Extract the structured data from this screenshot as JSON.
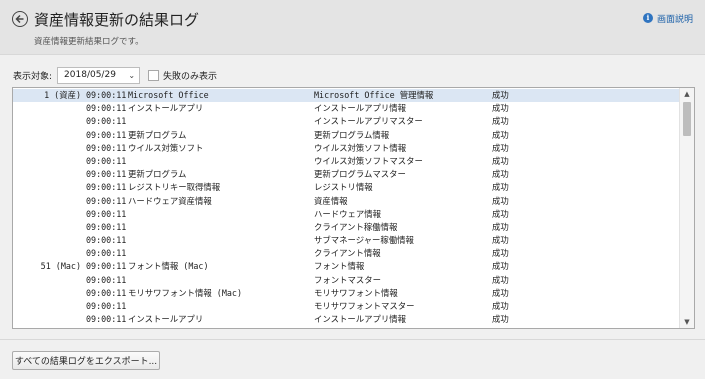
{
  "header": {
    "title": "資産情報更新の結果ログ",
    "subtitle": "資産情報更新結果ログです。",
    "help_label": "画面説明"
  },
  "filter": {
    "label": "表示対象:",
    "date_value": "2018/05/29",
    "failed_only_label": "失敗のみ表示",
    "failed_only_checked": false
  },
  "log": {
    "rows": [
      {
        "id": "1 (資産)",
        "time": "09:00:11",
        "name": "Microsoft Office",
        "detail": "Microsoft Office 管理情報",
        "status": "成功"
      },
      {
        "id": "",
        "time": "09:00:11",
        "name": "インストールアプリ",
        "detail": "インストールアプリ情報",
        "status": "成功"
      },
      {
        "id": "",
        "time": "09:00:11",
        "name": "",
        "detail": "インストールアプリマスター",
        "status": "成功"
      },
      {
        "id": "",
        "time": "09:00:11",
        "name": "更新プログラム",
        "detail": "更新プログラム情報",
        "status": "成功"
      },
      {
        "id": "",
        "time": "09:00:11",
        "name": "ウイルス対策ソフト",
        "detail": "ウイルス対策ソフト情報",
        "status": "成功"
      },
      {
        "id": "",
        "time": "09:00:11",
        "name": "",
        "detail": "ウイルス対策ソフトマスター",
        "status": "成功"
      },
      {
        "id": "",
        "time": "09:00:11",
        "name": "更新プログラム",
        "detail": "更新プログラムマスター",
        "status": "成功"
      },
      {
        "id": "",
        "time": "09:00:11",
        "name": "レジストリキー取得情報",
        "detail": "レジストリ情報",
        "status": "成功"
      },
      {
        "id": "",
        "time": "09:00:11",
        "name": "ハードウェア資産情報",
        "detail": "資産情報",
        "status": "成功"
      },
      {
        "id": "",
        "time": "09:00:11",
        "name": "",
        "detail": "ハードウェア情報",
        "status": "成功"
      },
      {
        "id": "",
        "time": "09:00:11",
        "name": "",
        "detail": "クライアント稼働情報",
        "status": "成功"
      },
      {
        "id": "",
        "time": "09:00:11",
        "name": "",
        "detail": "サブマネージャー稼働情報",
        "status": "成功"
      },
      {
        "id": "",
        "time": "09:00:11",
        "name": "",
        "detail": "クライアント情報",
        "status": "成功"
      },
      {
        "id": "51 (Mac)",
        "time": "09:00:11",
        "name": "フォント情報 (Mac)",
        "detail": "フォント情報",
        "status": "成功"
      },
      {
        "id": "",
        "time": "09:00:11",
        "name": "",
        "detail": "フォントマスター",
        "status": "成功"
      },
      {
        "id": "",
        "time": "09:00:11",
        "name": "モリサワフォント情報 (Mac)",
        "detail": "モリサワフォント情報",
        "status": "成功"
      },
      {
        "id": "",
        "time": "09:00:11",
        "name": "",
        "detail": "モリサワフォントマスター",
        "status": "成功"
      },
      {
        "id": "",
        "time": "09:00:11",
        "name": "インストールアプリ",
        "detail": "インストールアプリ情報",
        "status": "成功"
      }
    ]
  },
  "footer": {
    "export_label": "すべての結果ログをエクスポート..."
  }
}
